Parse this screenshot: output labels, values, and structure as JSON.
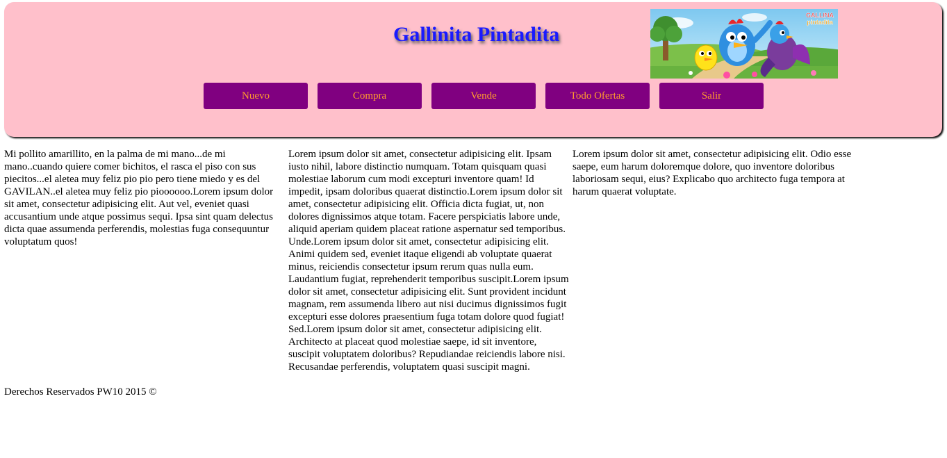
{
  "header": {
    "title": "Gallinita Pintadita",
    "banner": {
      "text_line1": "GALLINA",
      "text_line2": "pintadita"
    }
  },
  "nav": {
    "items": [
      {
        "label": "Nuevo"
      },
      {
        "label": "Compra"
      },
      {
        "label": "Vende"
      },
      {
        "label": "Todo Ofertas"
      },
      {
        "label": "Salir"
      }
    ]
  },
  "content": {
    "col1": "Mi pollito amarillito, en la palma de mi mano...de mi mano..cuando quiere comer bichitos, el rasca el piso con sus piecitos...el aletea muy feliz pio pio pero tiene miedo y es del GAVILAN..el aletea muy feliz pio pioooooo.Lorem ipsum dolor sit amet, consectetur adipisicing elit. Aut vel, eveniet quasi accusantium unde atque possimus sequi. Ipsa sint quam delectus dicta quae assumenda perferendis, molestias fuga consequuntur voluptatum quos!",
    "col2": "Lorem ipsum dolor sit amet, consectetur adipisicing elit. Ipsam iusto nihil, labore distinctio numquam. Totam quisquam quasi molestiae laborum cum modi excepturi inventore quam! Id impedit, ipsam doloribus quaerat distinctio.Lorem ipsum dolor sit amet, consectetur adipisicing elit. Officia dicta fugiat, ut, non dolores dignissimos atque totam. Facere perspiciatis labore unde, aliquid aperiam quidem placeat ratione aspernatur sed temporibus. Unde.Lorem ipsum dolor sit amet, consectetur adipisicing elit. Animi quidem sed, eveniet itaque eligendi ab voluptate quaerat minus, reiciendis consectetur ipsum rerum quas nulla eum. Laudantium fugiat, reprehenderit temporibus suscipit.Lorem ipsum dolor sit amet, consectetur adipisicing elit. Sunt provident incidunt magnam, rem assumenda libero aut nisi ducimus dignissimos fugit excepturi esse dolores praesentium fuga totam dolore quod fugiat! Sed.Lorem ipsum dolor sit amet, consectetur adipisicing elit. Architecto at placeat quod molestiae saepe, id sit inventore, suscipit voluptatem doloribus? Repudiandae reiciendis labore nisi. Recusandae perferendis, voluptatem quasi suscipit magni.",
    "col3": "Lorem ipsum dolor sit amet, consectetur adipisicing elit. Odio esse saepe, eum harum doloremque dolore, quo inventore doloribus laboriosam sequi, eius? Explicabo quo architecto fuga tempora at harum quaerat voluptate."
  },
  "footer": {
    "text": "Derechos Reservados PW10 2015 ©"
  },
  "colors": {
    "header_bg": "#ffc0cb",
    "title": "#1a1aff",
    "nav_bg": "#800080",
    "nav_text": "#ff9a2e"
  }
}
